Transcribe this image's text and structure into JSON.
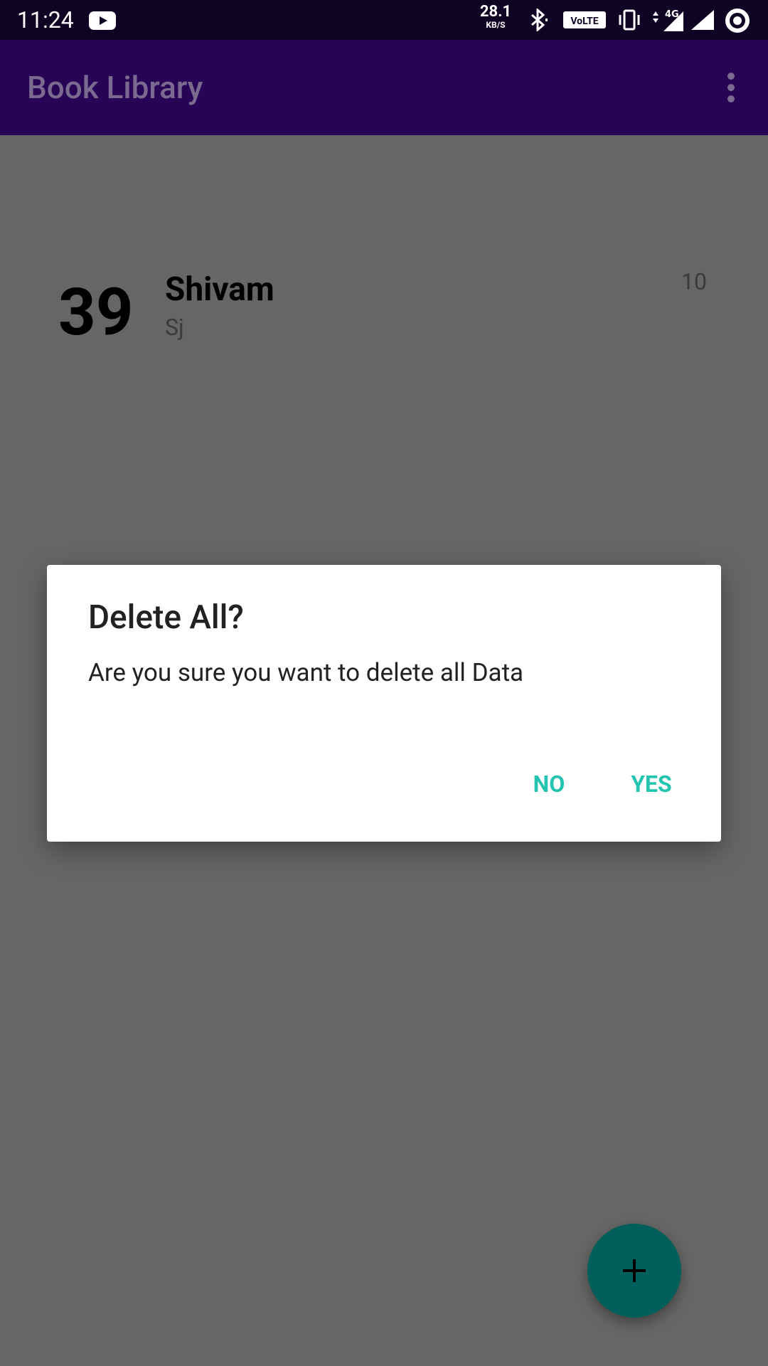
{
  "status_bar": {
    "time": "11:24",
    "speed_value": "28.1",
    "speed_unit": "KB/S",
    "volte_label": "VoLTE",
    "icons": [
      "youtube-icon",
      "bluetooth-icon",
      "volte-icon",
      "vibrate-icon",
      "4g-data-icon",
      "signal-icon",
      "ring-status-icon"
    ]
  },
  "app_bar": {
    "title": "Book Library",
    "menu_icon": "overflow-menu-icon"
  },
  "books": [
    {
      "id": "39",
      "title": "Shivam",
      "author": "Sj",
      "pages": "10"
    }
  ],
  "dialog": {
    "title": "Delete All?",
    "message": "Are you sure you want to delete all Data",
    "negative": "NO",
    "positive": "YES"
  },
  "fab": {
    "icon": "plus-icon"
  },
  "colors": {
    "status_bar": "#0e0323",
    "app_bar": "#280457",
    "scrim": "#666666",
    "dialog_button": "#23c4b0",
    "fab": "#005f5a"
  }
}
